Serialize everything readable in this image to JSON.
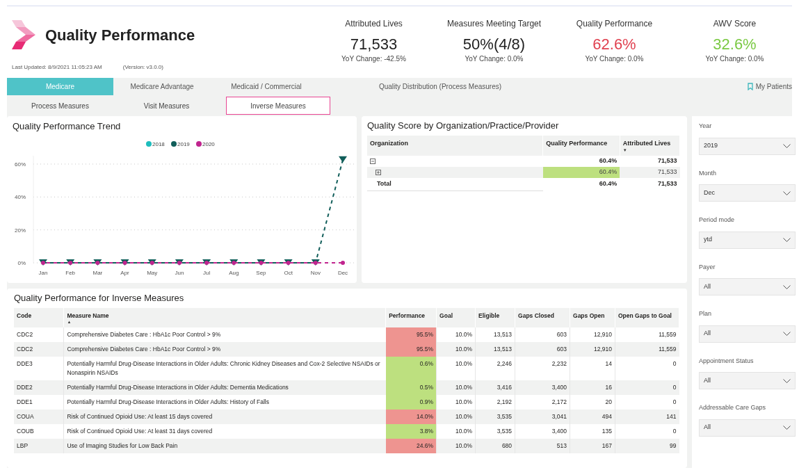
{
  "header": {
    "title": "Quality Performance",
    "last_updated": "Last Updated: 8/9/2021 11:05:23 AM",
    "version": "(Version: v3.0.0)"
  },
  "kpis": [
    {
      "label": "Attributed Lives",
      "value": "71,533",
      "change": "YoY Change: -42.5%"
    },
    {
      "label": "Measures Meeting Target",
      "value": "50%(4/8)",
      "change": "YoY Change: 0.0%"
    },
    {
      "label": "Quality Performance",
      "value": "62.6%",
      "change": "YoY Change: 0.0%",
      "color": "#e0404f"
    },
    {
      "label": "AWV Score",
      "value": "32.6%",
      "change": "YoY Change: 0.0%",
      "color": "#7ac943"
    }
  ],
  "tabs": [
    {
      "label": "Medicare",
      "selected": true
    },
    {
      "label": "Medicare Advantage",
      "selected": false
    },
    {
      "label": "Medicaid / Commercial",
      "selected": false
    },
    {
      "label": "Quality Distribution (Process Measures)",
      "selected": false
    }
  ],
  "my_patients": "My Patients",
  "subtabs": [
    {
      "label": "Process Measures",
      "selected": false
    },
    {
      "label": "Visit Measures",
      "selected": false
    },
    {
      "label": "Inverse Measures",
      "selected": true
    }
  ],
  "trend": {
    "title": "Quality Performance Trend",
    "chart_data": {
      "type": "line",
      "categories": [
        "Jan",
        "Feb",
        "Mar",
        "Apr",
        "May",
        "Jun",
        "Jul",
        "Aug",
        "Sep",
        "Oct",
        "Nov",
        "Dec"
      ],
      "series": [
        {
          "name": "2018",
          "color": "#1ebdbd",
          "values": [
            null,
            null,
            null,
            null,
            null,
            null,
            null,
            null,
            null,
            null,
            null,
            null
          ]
        },
        {
          "name": "2019",
          "color": "#115e5a",
          "line_style": "dashed",
          "marker": "triangle",
          "values": [
            0,
            0,
            0,
            0,
            0,
            0,
            0,
            0,
            0,
            0,
            0,
            62.6
          ]
        },
        {
          "name": "2020",
          "color": "#c0248e",
          "line_style": "dashed",
          "marker": "circle",
          "values": [
            0,
            0,
            0,
            0,
            0,
            0,
            0,
            0,
            0,
            0,
            0,
            0
          ]
        }
      ],
      "grid": true,
      "legend": true,
      "ylim": [
        0,
        65
      ],
      "yticks": [
        {
          "value": 0,
          "label": "0%"
        },
        {
          "value": 20,
          "label": "20%"
        },
        {
          "value": 40,
          "label": "40%"
        },
        {
          "value": 60,
          "label": "60%"
        }
      ]
    }
  },
  "org": {
    "title": "Quality Score by Organization/Practice/Provider",
    "columns": [
      {
        "label": "Organization"
      },
      {
        "label": "Quality Performance"
      },
      {
        "label": "Attributed Lives",
        "sort_arrow": "▼"
      }
    ],
    "rows": [
      {
        "kind": "group",
        "expanded": true,
        "performance": "60.4%",
        "lives": "71,533"
      },
      {
        "kind": "child",
        "expanded": false,
        "performance": "60.4%",
        "lives": "71,533",
        "color": "#bde07f"
      },
      {
        "kind": "total",
        "label": "Total",
        "performance": "60.4%",
        "lives": "71,533"
      }
    ]
  },
  "filters": [
    {
      "label": "Year",
      "value": "2019"
    },
    {
      "label": "Month",
      "value": "Dec"
    },
    {
      "label": "Period mode",
      "value": "ytd"
    },
    {
      "label": "Payer",
      "value": "All"
    },
    {
      "label": "Plan",
      "value": "All"
    },
    {
      "label": "Appointment Status",
      "value": "All"
    },
    {
      "label": "Addressable Care Gaps",
      "value": "All"
    }
  ],
  "measures": {
    "title": "Quality Performance for Inverse Measures",
    "columns": [
      {
        "label": "Code"
      },
      {
        "label": "Measure Name",
        "sort_arrow": "▲"
      },
      {
        "label": "Performance"
      },
      {
        "label": "Goal"
      },
      {
        "label": "Eligible"
      },
      {
        "label": "Gaps Closed"
      },
      {
        "label": "Gaps Open"
      },
      {
        "label": "Open Gaps to Goal"
      }
    ],
    "rows": [
      {
        "code": "CDC2",
        "name": "Comprehensive Diabetes Care : HbA1c Poor Control > 9%",
        "performance": "95.5%",
        "color": "#ee9490",
        "goal": "10.0%",
        "eligible": "13,513",
        "gaps_closed": "603",
        "gaps_open": "12,910",
        "open_gaps_to_goal": "11,559"
      },
      {
        "code": "CDC2",
        "name": "Comprehensive Diabetes Care : HbA1c Poor Control > 9%",
        "performance": "95.5%",
        "color": "#ee9490",
        "goal": "10.0%",
        "eligible": "13,513",
        "gaps_closed": "603",
        "gaps_open": "12,910",
        "open_gaps_to_goal": "11,559"
      },
      {
        "code": "DDE3",
        "name": "Potentially Harmful Drug-Disease Interactions in Older Adults: Chronic Kidney Diseases and Cox-2 Selective NSAIDs or Nonaspirin NSAIDs",
        "performance": "0.6%",
        "color": "#bde07f",
        "goal": "10.0%",
        "eligible": "2,246",
        "gaps_closed": "2,232",
        "gaps_open": "14",
        "open_gaps_to_goal": "0"
      },
      {
        "code": "DDE2",
        "name": "Potentially Harmful Drug-Disease Interactions in Older Adults: Dementia Medications",
        "performance": "0.5%",
        "color": "#bde07f",
        "goal": "10.0%",
        "eligible": "3,416",
        "gaps_closed": "3,400",
        "gaps_open": "16",
        "open_gaps_to_goal": "0"
      },
      {
        "code": "DDE1",
        "name": "Potentially Harmful Drug-Disease Interactions in Older Adults: History of Falls",
        "performance": "0.9%",
        "color": "#bde07f",
        "goal": "10.0%",
        "eligible": "2,192",
        "gaps_closed": "2,172",
        "gaps_open": "20",
        "open_gaps_to_goal": "0"
      },
      {
        "code": "COUA",
        "name": "Risk of Continued Opioid Use: At least 15 days covered",
        "performance": "14.0%",
        "color": "#ee9490",
        "goal": "10.0%",
        "eligible": "3,535",
        "gaps_closed": "3,041",
        "gaps_open": "494",
        "open_gaps_to_goal": "141"
      },
      {
        "code": "COUB",
        "name": "Risk of Continued Opioid Use: At least 31 days covered",
        "performance": "3.8%",
        "color": "#bde07f",
        "goal": "10.0%",
        "eligible": "3,535",
        "gaps_closed": "3,400",
        "gaps_open": "135",
        "open_gaps_to_goal": "0"
      },
      {
        "code": "LBP",
        "name": "Use of Imaging Studies for Low Back Pain",
        "performance": "24.6%",
        "color": "#ee9490",
        "goal": "10.0%",
        "eligible": "680",
        "gaps_closed": "513",
        "gaps_open": "167",
        "open_gaps_to_goal": "99"
      }
    ]
  }
}
